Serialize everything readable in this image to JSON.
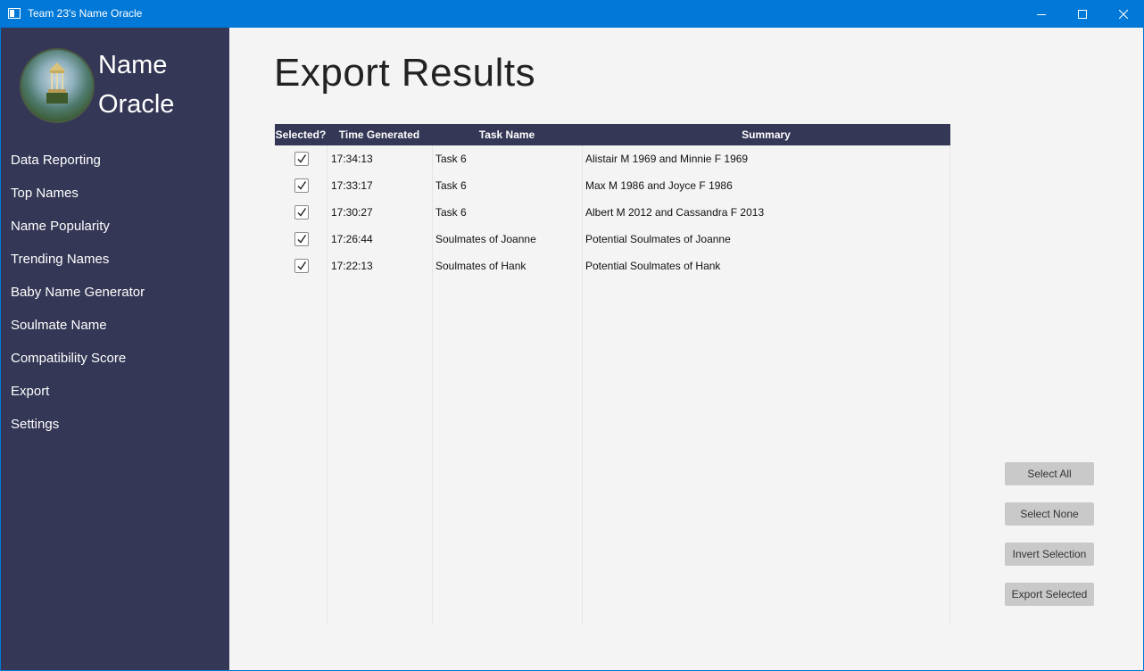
{
  "window": {
    "title": "Team 23's Name Oracle"
  },
  "sidebar": {
    "brand_line1": "Name",
    "brand_line2": "Oracle",
    "items": [
      {
        "label": "Data Reporting"
      },
      {
        "label": "Top Names"
      },
      {
        "label": "Name Popularity"
      },
      {
        "label": "Trending Names"
      },
      {
        "label": "Baby Name Generator"
      },
      {
        "label": "Soulmate Name"
      },
      {
        "label": "Compatibility Score"
      },
      {
        "label": "Export"
      },
      {
        "label": "Settings"
      }
    ]
  },
  "main": {
    "title": "Export Results",
    "table": {
      "columns": [
        "Selected?",
        "Time Generated",
        "Task Name",
        "Summary"
      ],
      "rows": [
        {
          "selected": true,
          "time": "17:34:13",
          "task": "Task 6",
          "summary": "Alistair M 1969 and Minnie F 1969"
        },
        {
          "selected": true,
          "time": "17:33:17",
          "task": "Task 6",
          "summary": "Max M 1986 and Joyce F 1986"
        },
        {
          "selected": true,
          "time": "17:30:27",
          "task": "Task 6",
          "summary": "Albert M 2012 and Cassandra F 2013"
        },
        {
          "selected": true,
          "time": "17:26:44",
          "task": "Soulmates of Joanne",
          "summary": "Potential Soulmates of Joanne"
        },
        {
          "selected": true,
          "time": "17:22:13",
          "task": "Soulmates of Hank",
          "summary": "Potential Soulmates of Hank"
        }
      ]
    },
    "buttons": {
      "select_all": "Select All",
      "select_none": "Select None",
      "invert_selection": "Invert Selection",
      "export_selected": "Export Selected"
    }
  },
  "colors": {
    "sidebar_bg": "#343755",
    "titlebar_bg": "#0078d7",
    "content_bg": "#f4f4f4",
    "button_bg": "#c9c9c9"
  },
  "icons": {
    "app": "app-window-icon",
    "minimize": "minimize-icon",
    "maximize": "maximize-icon",
    "close": "close-icon",
    "logo": "oracle-temple-logo",
    "checkbox": "checkmark-icon"
  }
}
